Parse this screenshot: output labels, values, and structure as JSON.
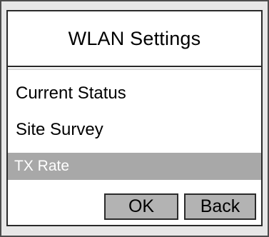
{
  "dialog": {
    "title": "WLAN Settings"
  },
  "menu": {
    "items": [
      {
        "label": "Current Status"
      },
      {
        "label": "Site Survey"
      },
      {
        "label": "TX Rate",
        "selected": true
      }
    ]
  },
  "buttons": {
    "ok_label": "OK",
    "back_label": "Back"
  },
  "colors": {
    "selection_background": "#a8a8a8",
    "selection_text": "#ffffff",
    "button_background": "#b3b3b3"
  }
}
